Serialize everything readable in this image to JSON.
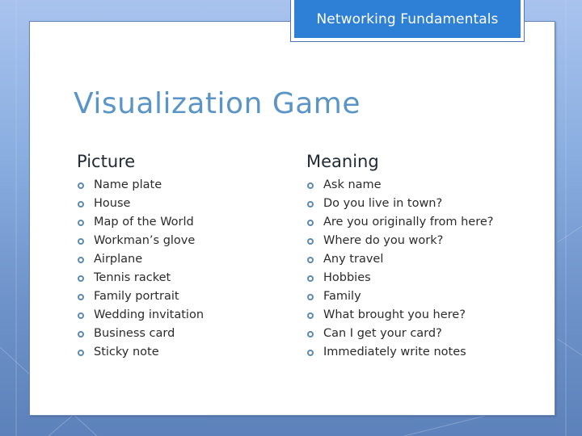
{
  "header": {
    "label": "Networking Fundamentals"
  },
  "slide": {
    "title": "Visualization Game",
    "columns": [
      {
        "heading": "Picture",
        "items": [
          "Name plate",
          "House",
          "Map of the World",
          "Workman’s glove",
          "Airplane",
          "Tennis racket",
          "Family portrait",
          "Wedding invitation",
          "Business card",
          "Sticky note"
        ]
      },
      {
        "heading": "Meaning",
        "items": [
          "Ask name",
          "Do you live in town?",
          "Are you originally from here?",
          "Where do you work?",
          "Any travel",
          "Hobbies",
          "Family",
          "What brought you here?",
          "Can I get your card?",
          "Immediately write notes"
        ]
      }
    ]
  },
  "icons": {
    "bullet": "circle-bullet-icon"
  },
  "colors": {
    "header_fill": "#2e7fd6",
    "title": "#5b95c8",
    "bullet": "#5d8ab0"
  }
}
